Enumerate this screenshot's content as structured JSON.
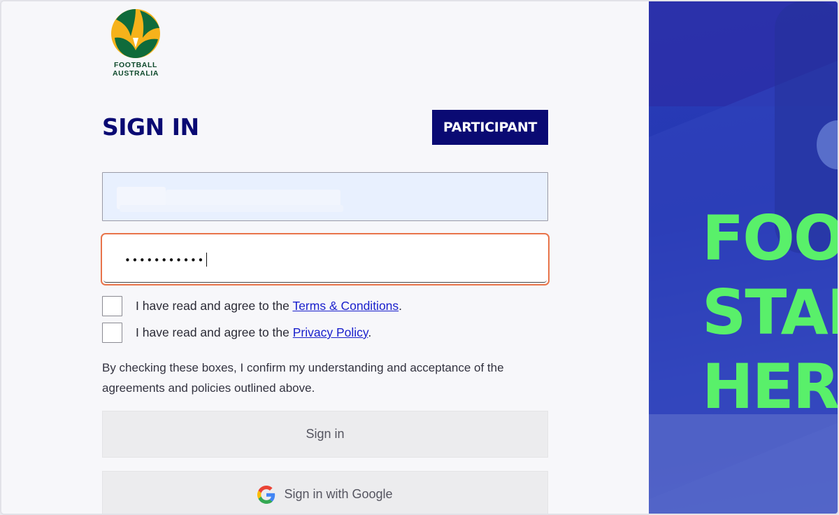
{
  "brand": {
    "logo_line1": "FOOTBALL",
    "logo_line2": "AUSTRALIA",
    "colors": {
      "green": "#0f6b3b",
      "gold": "#f6b21b",
      "navy": "#0a0a73",
      "accent_green": "#59f06a"
    }
  },
  "form": {
    "title": "SIGN IN",
    "badge": "PARTICIPANT",
    "password_mask": "•••••••••••",
    "terms_prefix": "I have read and agree to the ",
    "terms_link": "Terms & Conditions",
    "terms_suffix": ".",
    "privacy_prefix": "I have read and agree to the ",
    "privacy_link": "Privacy Policy",
    "privacy_suffix": ".",
    "confirm_text": "By checking these boxes, I confirm my understanding and acceptance of the agreements and policies outlined above.",
    "sign_in_label": "Sign in",
    "google_label": "Sign in with Google"
  },
  "hero": {
    "line1": "FOO",
    "line2": "STAR",
    "line3": "HER"
  },
  "icons": [
    "football-australia-logo",
    "google-icon"
  ]
}
